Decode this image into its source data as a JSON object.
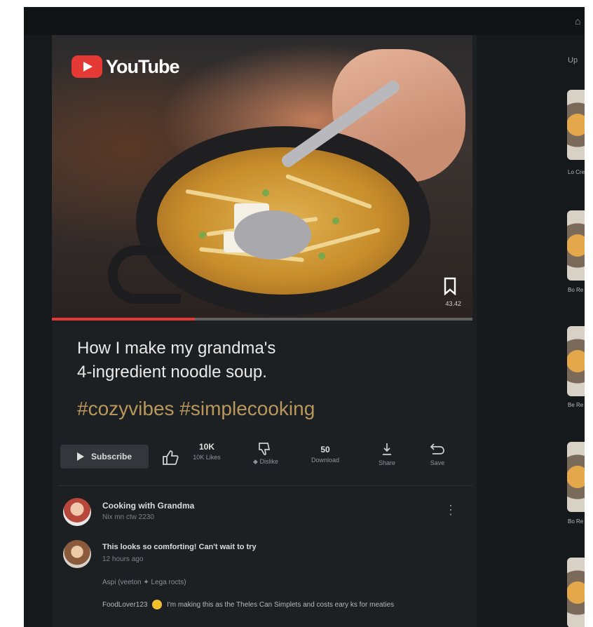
{
  "app": {
    "logo_text": "YouTube"
  },
  "player": {
    "progress_percent": 34,
    "save_label": "43.42"
  },
  "video": {
    "title_line1": "How I make my grandma's",
    "title_line2": "4-ingredient noodle soup.",
    "hashtags": "#cozyvibes #simplecooking"
  },
  "actions": {
    "subscribe_label": "Subscribe",
    "like": {
      "value": "10K",
      "label": "10K Likes"
    },
    "dislike": {
      "label": "Dislike"
    },
    "download": {
      "value": "50",
      "label": "Download"
    },
    "share": {
      "label": "Share"
    },
    "save": {
      "label": "Save"
    }
  },
  "channel": {
    "name": "Cooking with Grandma",
    "meta": "Nix mn ctw 2230"
  },
  "comments": [
    {
      "text": "This looks so comforting! Can't wait to try",
      "time": "12 hours ago",
      "reply_meta": "Aspi (veeton  ✦ Lega rocts)"
    },
    {
      "author": "FoodLover123",
      "text": "I'm making this as the Theles Can Simplets and costs eary ks for meaties"
    }
  ],
  "sidebar": {
    "heading": "Up",
    "items": [
      {
        "title": "Lo Cre"
      },
      {
        "title": "Bo Re"
      },
      {
        "title": "Be Re"
      },
      {
        "title": "Bo Re"
      }
    ]
  },
  "colors": {
    "accent": "#e53935",
    "hashtag": "#b9975b",
    "background": "#1d2023"
  },
  "icons": [
    "youtube-logo-icon",
    "bookmark-icon",
    "play-icon",
    "thumbs-up-icon",
    "thumbs-down-icon",
    "download-icon",
    "share-icon",
    "save-icon",
    "more-vert-icon"
  ]
}
